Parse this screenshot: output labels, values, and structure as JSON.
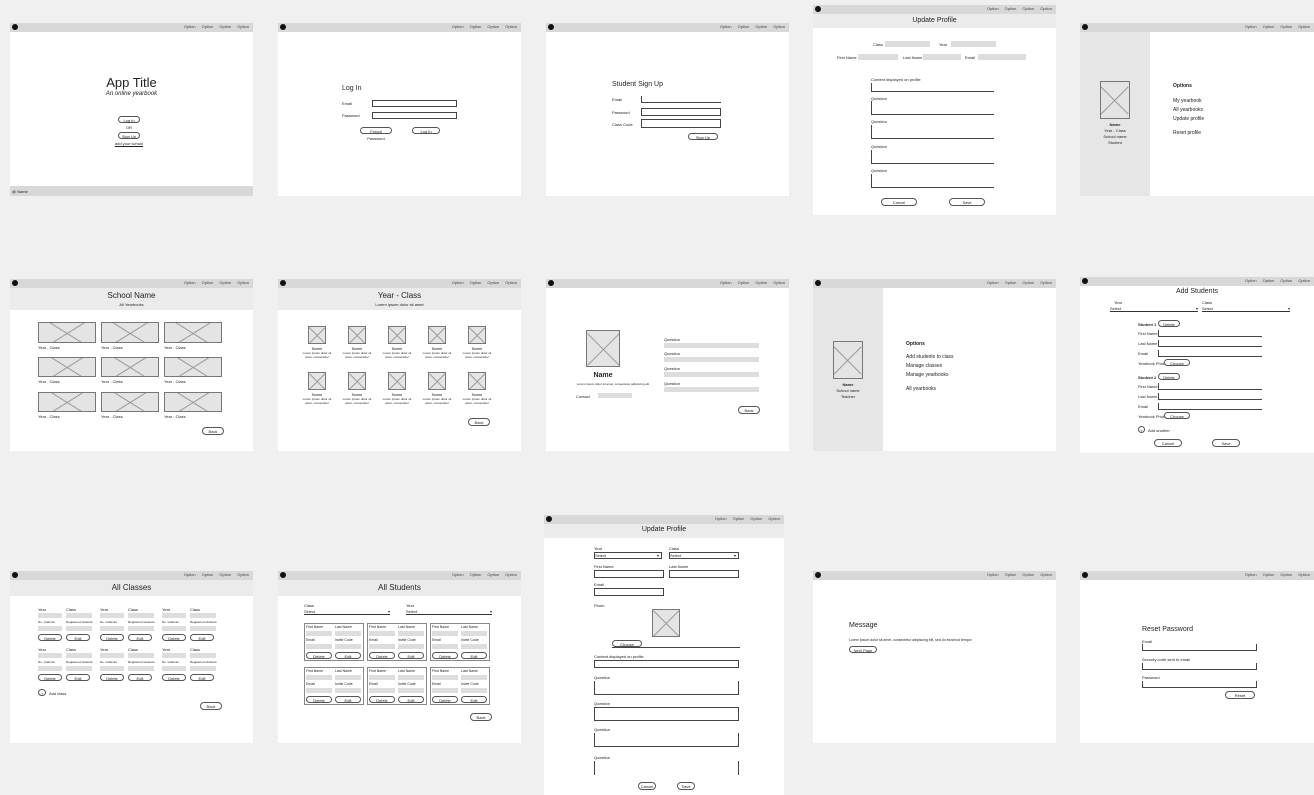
{
  "top_menu": [
    "Option",
    "Option",
    "Option",
    "Option"
  ],
  "landing": {
    "title": "App Title",
    "subtitle": "An online yearbook",
    "login": "Log In",
    "or": "OR",
    "signup": "Sign Up",
    "school_link": "add your school",
    "footer": "@ Name"
  },
  "login": {
    "title": "Log In",
    "email": "Email",
    "password": "Password",
    "forgot": "Forgot Password",
    "submit": "Log In"
  },
  "signup": {
    "title": "Student Sign Up",
    "email": "Email",
    "password": "Password",
    "code": "Class Code",
    "submit": "Sign Up"
  },
  "update_profile_a": {
    "title": "Update Profile",
    "class": "Class",
    "year": "Year",
    "first_name": "First Name",
    "last_name": "Last Name",
    "email": "Email",
    "content": "Content displayed on profile",
    "question": "Question",
    "cancel": "Cancel",
    "save": "Save"
  },
  "student_home": {
    "name": "Name",
    "sub1": "Year - Class",
    "sub2": "School name",
    "sub3": "Student",
    "options_title": "Options",
    "options": [
      "My yearbook",
      "All yearbooks",
      "Update profile",
      "Reset profile"
    ]
  },
  "school": {
    "title": "School Name",
    "subtitle": "All Yearbooks",
    "tiles": [
      "Year - Class",
      "Year - Class",
      "Year - Class",
      "Year - Class",
      "Year - Class",
      "Year - Class",
      "Year - Class",
      "Year - Class",
      "Year - Class"
    ],
    "back": "Back"
  },
  "year_class": {
    "title": "Year - Class",
    "subtitle": "Lorem ipsum dolor sit amet",
    "item_name": "Name",
    "item_text": "Lorem ipsum dolor sit amet, consectetur",
    "back": "Back"
  },
  "profile": {
    "name": "Name",
    "bio": "Lorem ipsum dolor sit amet, consectetur adipiscing elit",
    "contact": "Contact",
    "questions": [
      "Question",
      "Question",
      "Question",
      "Question"
    ],
    "back": "Back"
  },
  "teacher_home": {
    "name": "Name",
    "sub1": "School name",
    "sub2": "Teacher",
    "options_title": "Options",
    "options": [
      "Add students to class",
      "Manage classes",
      "Manage yearbooks",
      "All yearbooks"
    ]
  },
  "add_students": {
    "title": "Add Students",
    "year": "Year",
    "year_value": "Select",
    "class": "Class",
    "class_value": "Select",
    "student_label": "Student",
    "delete": "Delete",
    "first_name": "First Name",
    "last_name": "Last Name",
    "email": "Email",
    "photo": "Yearbook Photo",
    "choose": "Choose",
    "add_another": "Add another",
    "cancel": "Cancel",
    "save": "Save",
    "students": [
      "Student 1",
      "Student 2"
    ]
  },
  "all_classes": {
    "title": "All Classes",
    "year": "Year",
    "class": "Class",
    "students": "No. students",
    "registered": "Registered students",
    "delete": "Delete",
    "edit": "Edit",
    "add_class": "Add class",
    "back": "Back"
  },
  "all_students": {
    "title": "All Students",
    "class": "Class",
    "class_value": "Select",
    "year": "Year",
    "year_value": "Select",
    "first_name": "First Name",
    "last_name": "Last Name",
    "email": "Email",
    "code": "Invite Code",
    "delete": "Delete",
    "edit": "Edit",
    "back": "Back"
  },
  "update_profile_b": {
    "title": "Update Profile",
    "year": "Year",
    "year_value": "Select",
    "class": "Class",
    "class_value": "Select",
    "first_name": "First Name",
    "last_name": "Last Name",
    "email": "Email",
    "photo": "Photo",
    "choose": "Choose",
    "content": "Content displayed on profile",
    "question": "Question",
    "cancel": "Cancel",
    "save": "Save"
  },
  "message": {
    "title": "Message",
    "text": "Lorem ipsum dolor sit amet, consectetur adipiscing elit, sed do eiusmod tempor",
    "button": "Next Page"
  },
  "reset": {
    "title": "Reset Password",
    "email": "Email",
    "code": "Security code sent to email",
    "password": "Password",
    "submit": "Reset"
  }
}
